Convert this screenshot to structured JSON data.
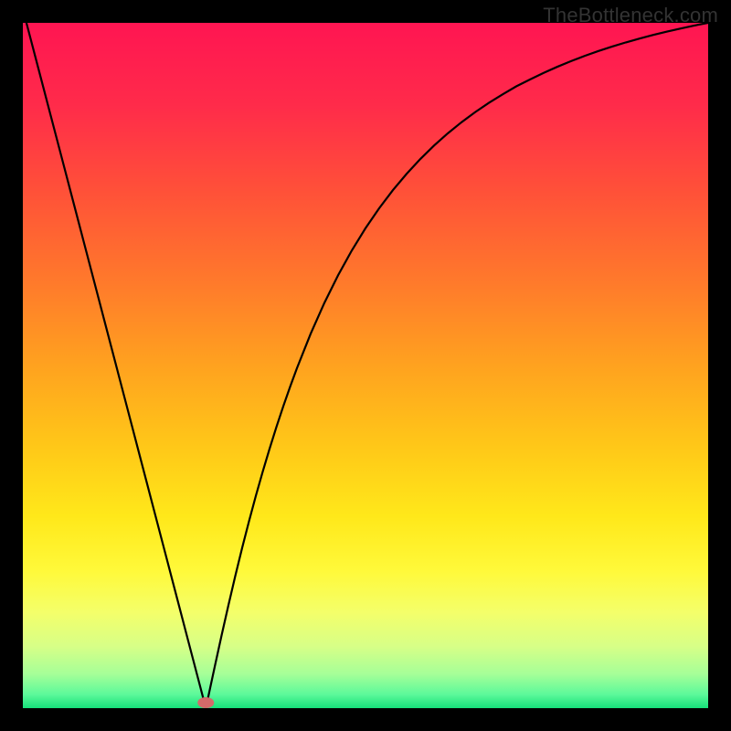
{
  "watermark": "TheBottleneck.com",
  "chart_data": {
    "type": "line",
    "title": "",
    "xlabel": "",
    "ylabel": "",
    "xlim": [
      0,
      100
    ],
    "ylim": [
      0,
      100
    ],
    "grid": false,
    "legend": false,
    "series": [
      {
        "name": "bottleneck-curve",
        "color": "#000000",
        "stroke_width": 2.2,
        "x": [
          0,
          1,
          2,
          3,
          4,
          5,
          6,
          7,
          8,
          9,
          10,
          11,
          12,
          13,
          14,
          15,
          16,
          17,
          18,
          19,
          20,
          21,
          22,
          23,
          24,
          25,
          26,
          26.7,
          27,
          28,
          29,
          30,
          31,
          32,
          33,
          34,
          35,
          36,
          37,
          38,
          39,
          40,
          42,
          44,
          46,
          48,
          50,
          52,
          54,
          56,
          58,
          60,
          62,
          64,
          66,
          68,
          70,
          72,
          74,
          76,
          78,
          80,
          82,
          84,
          86,
          88,
          90,
          92,
          94,
          96,
          98,
          100
        ],
        "y": [
          102,
          98.18,
          94.36,
          90.54,
          86.72,
          82.9,
          79.08,
          75.26,
          71.44,
          67.62,
          63.8,
          59.98,
          56.16,
          52.34,
          48.52,
          44.7,
          40.88,
          37.06,
          33.24,
          29.42,
          25.6,
          21.78,
          17.96,
          14.14,
          10.32,
          6.5,
          2.68,
          0.01,
          1.4,
          6.05,
          10.61,
          15.04,
          19.3,
          23.38,
          27.27,
          30.98,
          34.5,
          37.85,
          41.03,
          44.04,
          46.9,
          49.62,
          54.64,
          59.14,
          63.17,
          66.78,
          70.03,
          72.95,
          75.59,
          77.97,
          80.13,
          82.09,
          83.87,
          85.49,
          86.97,
          88.32,
          89.56,
          90.73,
          91.73,
          92.7,
          93.59,
          94.42,
          95.18,
          95.89,
          96.54,
          97.15,
          97.71,
          98.24,
          98.73,
          99.18,
          99.61,
          100
        ]
      }
    ],
    "marker": {
      "x": 26.7,
      "y": 0.8,
      "color": "#d46a6a",
      "rx_frac": 0.012,
      "ry_frac": 0.008
    },
    "background_gradient": {
      "direction": "vertical",
      "stops": [
        {
          "offset": 0.0,
          "color": "#ff1552"
        },
        {
          "offset": 0.12,
          "color": "#ff2b4a"
        },
        {
          "offset": 0.25,
          "color": "#ff5238"
        },
        {
          "offset": 0.38,
          "color": "#ff7a2b"
        },
        {
          "offset": 0.5,
          "color": "#ffa21f"
        },
        {
          "offset": 0.62,
          "color": "#ffc818"
        },
        {
          "offset": 0.72,
          "color": "#ffe81a"
        },
        {
          "offset": 0.8,
          "color": "#fff93a"
        },
        {
          "offset": 0.86,
          "color": "#f4ff6a"
        },
        {
          "offset": 0.91,
          "color": "#d7ff87"
        },
        {
          "offset": 0.95,
          "color": "#a6ff98"
        },
        {
          "offset": 0.98,
          "color": "#5cf99a"
        },
        {
          "offset": 1.0,
          "color": "#16e07a"
        }
      ]
    }
  }
}
